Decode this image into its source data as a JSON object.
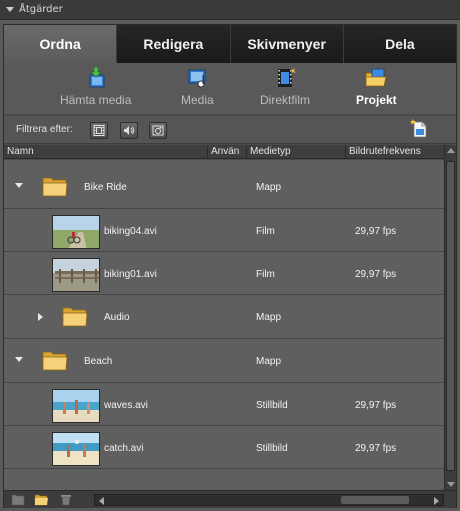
{
  "panel": {
    "title": "Åtgärder"
  },
  "tabs": [
    {
      "label": "Ordna",
      "active": true
    },
    {
      "label": "Redigera",
      "active": false
    },
    {
      "label": "Skivmenyer",
      "active": false
    },
    {
      "label": "Dela",
      "active": false
    }
  ],
  "toolbar": {
    "items": [
      {
        "label": "Hämta media",
        "icon": "get-media-icon"
      },
      {
        "label": "Media",
        "icon": "media-icon"
      },
      {
        "label": "Direktfilm",
        "icon": "instant-movie-icon"
      },
      {
        "label": "Projekt",
        "icon": "project-icon",
        "selected": true
      }
    ]
  },
  "filter": {
    "label": "Filtrera efter:",
    "buttons": [
      "video-filter-icon",
      "audio-filter-icon",
      "image-filter-icon"
    ],
    "new_item_icon": "new-item-icon"
  },
  "columns": {
    "name": "Namn",
    "used": "Använ",
    "mediatype": "Medietyp",
    "framerate": "Bildrutefrekvens"
  },
  "rows": [
    {
      "kind": "folder",
      "expanded": true,
      "indent": 0,
      "name": "Bike Ride",
      "type": "Mapp",
      "fps": ""
    },
    {
      "kind": "clip",
      "indent": 1,
      "name": "biking04.avi",
      "type": "Film",
      "fps": "29,97 fps",
      "thumb": "road"
    },
    {
      "kind": "clip",
      "indent": 1,
      "name": "biking01.avi",
      "type": "Film",
      "fps": "29,97 fps",
      "thumb": "fence"
    },
    {
      "kind": "folder",
      "expanded": false,
      "indent": 1,
      "name": "Audio",
      "type": "Mapp",
      "fps": ""
    },
    {
      "kind": "folder",
      "expanded": true,
      "indent": 0,
      "name": "Beach",
      "type": "Mapp",
      "fps": ""
    },
    {
      "kind": "clip",
      "indent": 1,
      "name": "waves.avi",
      "type": "Stillbild",
      "fps": "29,97 fps",
      "thumb": "beach1"
    },
    {
      "kind": "clip",
      "indent": 1,
      "name": "catch.avi",
      "type": "Stillbild",
      "fps": "29,97 fps",
      "thumb": "beach2"
    }
  ],
  "bottom": {
    "icons": [
      "new-folder-icon",
      "folder-icon",
      "trash-icon"
    ]
  }
}
